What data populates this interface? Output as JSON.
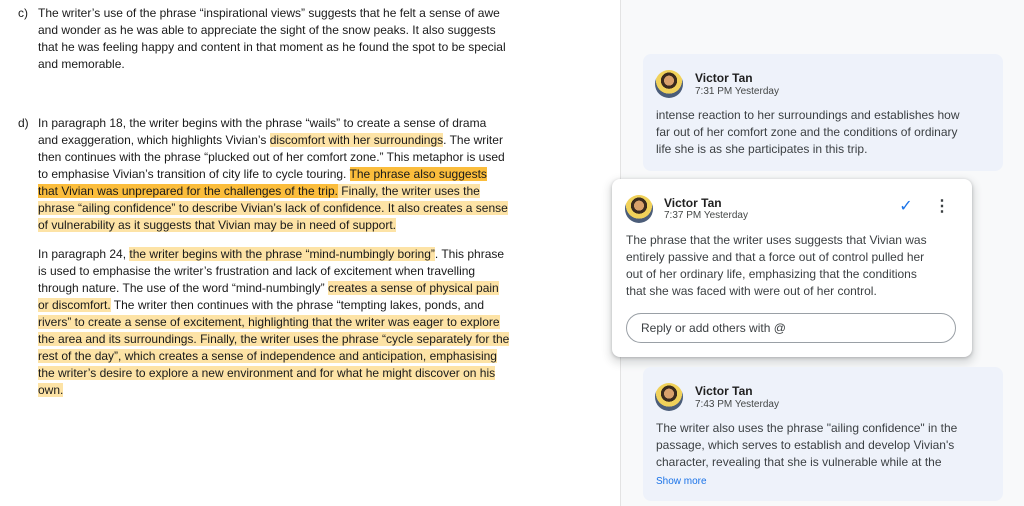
{
  "doc": {
    "para_c": {
      "marker": "c)",
      "lines": [
        "The writer’s use of the phrase “inspirational views” suggests that he felt a sense of awe",
        "and wonder as he was able to appreciate the sight of the snow peaks. It also suggests",
        "that he was feeling happy and content in that moment as he found the spot to be special",
        "and memorable."
      ]
    },
    "para_d": {
      "marker": "d)",
      "l1": "In paragraph 18, the writer begins with the phrase “wails” to create a sense of drama",
      "l2a": "and exaggeration, which highlights Vivian’s ",
      "l2b": "discomfort with her surroundings",
      "l2c": ". The writer",
      "l3": "then continues with the phrase “plucked out of her comfort zone.” This metaphor is used",
      "l4a": "to emphasise Vivian’s transition of city life to cycle touring. ",
      "l4b": "The phrase also suggests",
      "l5a": "that Vivian was unprepared for the challenges of the trip.",
      "l5b": " Finally, the writer uses the",
      "l6": "phrase “ailing confidence” to describe Vivian’s lack of confidence. It also creates a sense",
      "l7": "of vulnerability as it suggests that Vivian may be in need of support."
    },
    "para_e": {
      "l1a": "In paragraph 24, ",
      "l1b": "the writer begins with the phrase “mind-numbingly boring”",
      "l1c": ". This phrase",
      "l2": "is used to emphasise the writer’s frustration and lack of excitement when travelling",
      "l3a": "through nature. The use of the word “mind-numbingly” ",
      "l3b": "creates a sense of physical pain",
      "l4a": "or discomfort.",
      "l4b": " The writer then continues with the phrase “tempting lakes, ponds, and",
      "l5": "rivers” to create a sense of excitement, highlighting that the writer was eager to explore",
      "l6": "the area and its surroundings. Finally, the writer uses the phrase “cycle separately for the",
      "l7": "rest of the day”, which creates a sense of independence and anticipation, emphasising",
      "l8": "the writer’s desire to explore a new environment and for what he might discover on his",
      "l9": "own."
    }
  },
  "comments": [
    {
      "author": "Victor Tan",
      "time": "7:31 PM Yesterday",
      "lines": [
        "intense reaction to her surroundings and establishes how",
        "far out of her comfort zone and the conditions of ordinary",
        "life she is as she participates in this trip."
      ]
    },
    {
      "author": "Victor Tan",
      "time": "7:37 PM Yesterday",
      "lines": [
        "The phrase that the writer uses suggests that Vivian was",
        "entirely passive and that a force out of control pulled her",
        "out of her ordinary life, emphasizing that the conditions",
        "that she was faced with were out of her control."
      ],
      "reply_placeholder": "Reply or add others with @",
      "resolve_icon": "check-icon",
      "more_icon": "more-vert-icon"
    },
    {
      "author": "Victor Tan",
      "time": "7:43 PM Yesterday",
      "lines": [
        "The writer also uses the phrase \"ailing confidence\" in the",
        "passage, which serves to establish and develop Vivian's",
        "character, revealing that she is vulnerable while at the"
      ],
      "show_more": "Show more"
    }
  ],
  "colors": {
    "highlight_light": "#fde3a6",
    "highlight_strong": "#fbbd3c",
    "accent": "#1a73e8",
    "card_bg": "#eef2fa"
  }
}
